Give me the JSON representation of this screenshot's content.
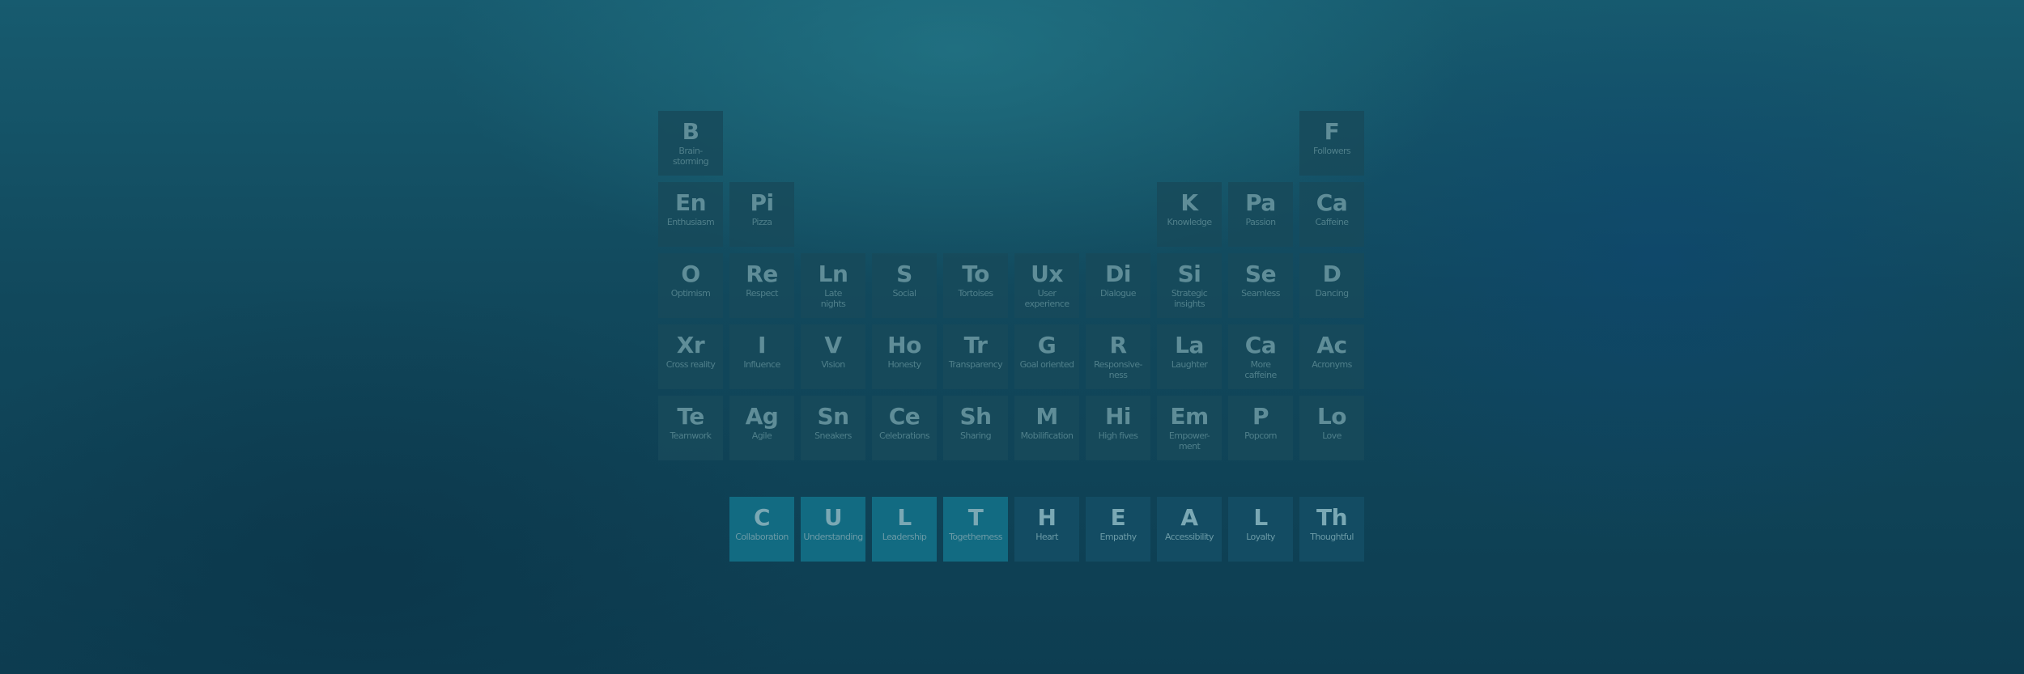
{
  "elements": [
    {
      "id": "brainstorming",
      "symbol": "B",
      "label": "Brain-\nstorming"
    },
    {
      "id": "followers",
      "symbol": "F",
      "label": "Followers"
    },
    {
      "id": "enthusiasm",
      "symbol": "En",
      "label": "Enthusiasm"
    },
    {
      "id": "pizza",
      "symbol": "Pi",
      "label": "Pizza"
    },
    {
      "id": "knowledge",
      "symbol": "K",
      "label": "Knowledge"
    },
    {
      "id": "passion",
      "symbol": "Pa",
      "label": "Passion"
    },
    {
      "id": "caffeine",
      "symbol": "Ca",
      "label": "Caffeine"
    },
    {
      "id": "optimism",
      "symbol": "O",
      "label": "Optimism"
    },
    {
      "id": "respect",
      "symbol": "Re",
      "label": "Respect"
    },
    {
      "id": "late-nights",
      "symbol": "Ln",
      "label": "Late\nnights"
    },
    {
      "id": "social",
      "symbol": "S",
      "label": "Social"
    },
    {
      "id": "tortoises",
      "symbol": "To",
      "label": "Tortoises"
    },
    {
      "id": "user-experience",
      "symbol": "Ux",
      "label": "User\nexperience"
    },
    {
      "id": "dialogue",
      "symbol": "Di",
      "label": "Dialogue"
    },
    {
      "id": "strategic-insights",
      "symbol": "Si",
      "label": "Strategic\ninsights"
    },
    {
      "id": "seamless",
      "symbol": "Se",
      "label": "Seamless"
    },
    {
      "id": "dancing",
      "symbol": "D",
      "label": "Dancing"
    },
    {
      "id": "cross-reality",
      "symbol": "Xr",
      "label": "Cross reality"
    },
    {
      "id": "influence",
      "symbol": "I",
      "label": "Influence"
    },
    {
      "id": "vision",
      "symbol": "V",
      "label": "Vision"
    },
    {
      "id": "honesty",
      "symbol": "Ho",
      "label": "Honesty"
    },
    {
      "id": "transparency",
      "symbol": "Tr",
      "label": "Transparency"
    },
    {
      "id": "goal-oriented",
      "symbol": "G",
      "label": "Goal oriented"
    },
    {
      "id": "responsiveness",
      "symbol": "R",
      "label": "Responsive-\nness"
    },
    {
      "id": "laughter",
      "symbol": "La",
      "label": "Laughter"
    },
    {
      "id": "more-caffeine",
      "symbol": "Ca",
      "label": "More\ncaffeine"
    },
    {
      "id": "acronyms",
      "symbol": "Ac",
      "label": "Acronyms"
    },
    {
      "id": "teamwork",
      "symbol": "Te",
      "label": "Teamwork"
    },
    {
      "id": "agile",
      "symbol": "Ag",
      "label": "Agile"
    },
    {
      "id": "sneakers",
      "symbol": "Sn",
      "label": "Sneakers"
    },
    {
      "id": "celebrations",
      "symbol": "Ce",
      "label": "Celebrations"
    },
    {
      "id": "sharing",
      "symbol": "Sh",
      "label": "Sharing"
    },
    {
      "id": "mobilification",
      "symbol": "M",
      "label": "Mobilification"
    },
    {
      "id": "high-fives",
      "symbol": "Hi",
      "label": "High fives"
    },
    {
      "id": "empowerment",
      "symbol": "Em",
      "label": "Empower-\nment"
    },
    {
      "id": "popcorn",
      "symbol": "P",
      "label": "Popcorn"
    },
    {
      "id": "love",
      "symbol": "Lo",
      "label": "Love"
    }
  ],
  "culture_row": [
    {
      "id": "collaboration",
      "symbol": "C",
      "label": "Collaboration"
    },
    {
      "id": "understanding",
      "symbol": "U",
      "label": "Understanding"
    },
    {
      "id": "leadership",
      "symbol": "L",
      "label": "Leadership"
    },
    {
      "id": "togetherness",
      "symbol": "T",
      "label": "Togetherness"
    },
    {
      "id": "heart",
      "symbol": "H",
      "label": "Heart"
    },
    {
      "id": "empathy",
      "symbol": "E",
      "label": "Empathy"
    },
    {
      "id": "accessibility",
      "symbol": "A",
      "label": "Accessibility"
    },
    {
      "id": "loyalty",
      "symbol": "L",
      "label": "Loyalty"
    },
    {
      "id": "thoughtful",
      "symbol": "Th",
      "label": "Thoughtful"
    }
  ]
}
